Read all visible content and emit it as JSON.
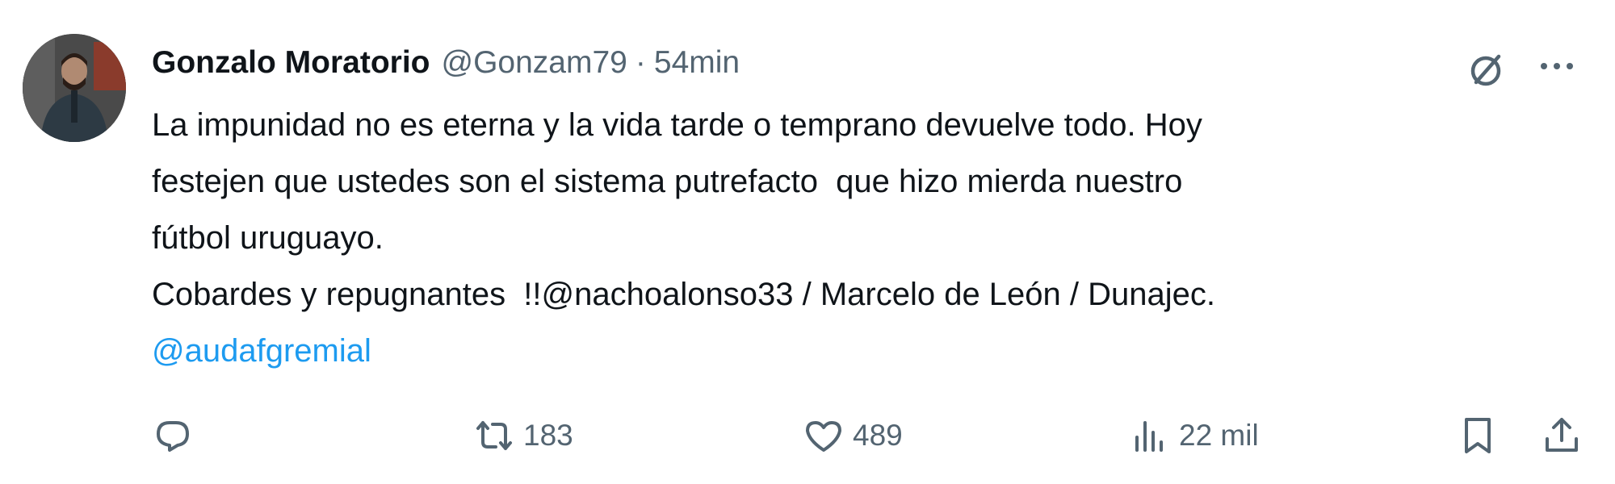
{
  "tweet": {
    "author": {
      "name": "Gonzalo Moratorio",
      "handle": "@Gonzam79",
      "separator": "·",
      "time": "54min"
    },
    "text": {
      "line1": "La impunidad no es eterna y la vida tarde o temprano devuelve todo. Hoy",
      "line2": "festejen que ustedes son el sistema putrefacto  que hizo mierda nuestro",
      "line3": "fútbol uruguayo.",
      "line4_prefix": "Cobardes y repugnantes  !!",
      "line4_mention": "@nachoalonso33",
      "line4_suffix": " / Marcelo de León / Dunajec.",
      "line5_mention": "@audafgremial"
    },
    "icons": {
      "grok": "grok-icon",
      "more": "more-icon",
      "reply": "reply-icon",
      "retweet": "retweet-icon",
      "like": "heart-icon",
      "views": "views-icon",
      "bookmark": "bookmark-icon",
      "share": "share-icon"
    },
    "actions": {
      "retweets": "183",
      "likes": "489",
      "views": "22 mil"
    },
    "colors": {
      "text": "#0f1419",
      "secondary": "#536471",
      "link": "#1d9bf0"
    }
  }
}
